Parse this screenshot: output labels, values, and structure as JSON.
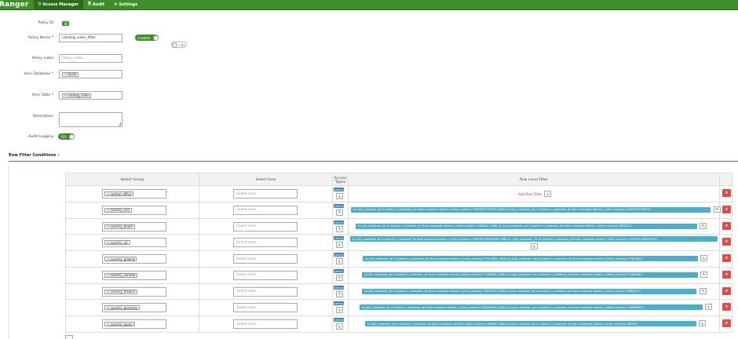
{
  "nav": {
    "brand": "Ranger",
    "items": [
      {
        "label": "Access Manager",
        "icon": "shield-icon",
        "glyph": "⛉"
      },
      {
        "label": "Audit",
        "icon": "document-icon",
        "glyph": "🗎"
      },
      {
        "label": "Settings",
        "icon": "gear-icon",
        "glyph": "⚙"
      }
    ]
  },
  "form": {
    "policy_id_label": "Policy ID",
    "policy_id_value": "36",
    "policy_name_label": "Policy Name *",
    "policy_name_value": "catalog_sales_filter",
    "enabled_label": "enabled",
    "override_label": "ride",
    "policy_label_label": "Policy Label",
    "policy_label_placeholder": "Policy Label",
    "hive_db_label": "Hive Database *",
    "hive_db_value": "tpcds",
    "hive_table_label": "Hive Table *",
    "hive_table_value": "catalog_sales",
    "description_label": "Description",
    "audit_label": "Audit Logging",
    "audit_value": "YES"
  },
  "section": {
    "title": "Row Filter Conditions :"
  },
  "table": {
    "headers": {
      "group": "Select Group",
      "user": "Select User",
      "access": "Access Types",
      "filter": "Row Level Filter"
    },
    "user_placeholder": "Select User",
    "access_badge": "select",
    "add_filter_label": "Add Row Filter",
    "rows": [
      {
        "group": "central_office",
        "filter": ""
      },
      {
        "group": "country_usa",
        "filter": "cs_bill_customer_sk in (select c_customer_sk from customer where c_birth_country='UNITED STATES') AND cs_ship_customer_sk in (select c_customer_sk from customer where c_birth_country='UNITED STATES')"
      },
      {
        "group": "country_brazil",
        "filter": "cs_bill_customer_sk in (select c_customer_sk from customer where c_birth_country='BRAZIL') AND cs_ship_customer_sk in (select c_customer_sk from customer where c_birth_country='BRAZIL')"
      },
      {
        "group": "country_uk",
        "filter": "cs_bill_customer_sk in (select c_customer_sk from customer where c_birth_country='UNITED KINGDOM') AND cs_ship_customer_sk in (select c_customer_sk from customer where c_birth_country='UNITED KINGDOM')"
      },
      {
        "group": "country_poland",
        "filter": "cs_bill_customer_sk in (select c_customer_sk from customer where c_birth_country='POLAND') AND cs_ship_customer_sk in (select c_customer_sk from customer where c_birth_country='POLAND')"
      },
      {
        "group": "country_canada",
        "filter": "cs_bill_customer_sk in (select c_customer_sk from customer where c_birth_country='CANADA') AND cs_ship_customer_sk in (select c_customer_sk from customer where c_birth_country='CANADA')"
      },
      {
        "group": "country_mexico",
        "filter": "cs_bill_customer_sk in (select c_customer_sk from customer where c_birth_country='MEXICO') AND cs_ship_customer_sk in (select c_customer_sk from customer where c_birth_country='MEXICO')"
      },
      {
        "group": "country_germany",
        "filter": "cs_bill_customer_sk in (select c_customer_sk from customer where c_birth_country='GERMANY') AND cs_ship_customer_sk in (select c_customer_sk from customer where c_birth_country='GERMANY')"
      },
      {
        "group": "country_japan",
        "filter": "cs_bill_customer_sk in (select c_customer_sk from customer where c_birth_country='JAPAN') AND cs_ship_customer_sk in (select c_customer_sk from customer where c_birth_country='JAPAN')"
      }
    ]
  },
  "colors": {
    "brand": "#3f8e28",
    "filter_badge": "#49afcd",
    "delete": "#da4f49"
  }
}
